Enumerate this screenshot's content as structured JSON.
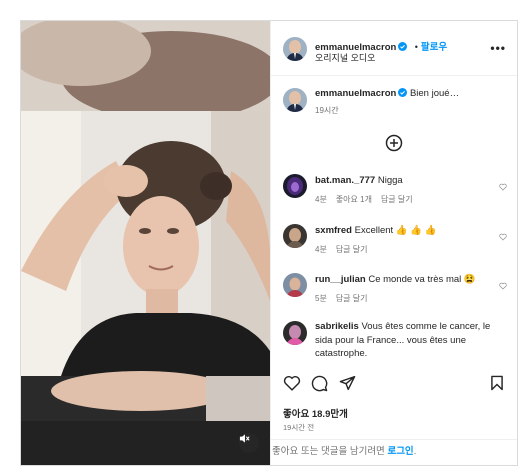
{
  "header": {
    "username": "emmanuelmacron",
    "separator": "•",
    "follow_label": "팔로우",
    "audio_label": "오리지널 오디오",
    "more_label": "•••"
  },
  "caption": {
    "username": "emmanuelmacron",
    "text": "Bien joué…",
    "time": "19시간"
  },
  "load_more_icon": "plus-circle-icon",
  "comments": [
    {
      "username": "bat.man._777",
      "text": "Nigga",
      "time": "4분",
      "likes": "좋아요 1개",
      "reply": "답글 달기"
    },
    {
      "username": "sxmfred",
      "text": "Excellent 👍 👍 👍",
      "time": "4분",
      "reply": "답글 달기"
    },
    {
      "username": "run__julian",
      "text": "Ce monde va très mal 😫",
      "time": "5분",
      "reply": "답글 달기"
    },
    {
      "username": "sabrikelis",
      "text": "Vous êtes comme le cancer, le sida pour la France... vous êtes une catastrophe."
    }
  ],
  "footer": {
    "likes": "좋아요 18.9만개",
    "time": "19시간 전",
    "add_comment_prefix": "좋아요 또는 댓글을 남기려면 ",
    "login_label": "로그인",
    "add_comment_suffix": "."
  },
  "colors": {
    "accent": "#0095f6",
    "verified": "#0095f6",
    "text": "#262626",
    "muted": "#737373"
  }
}
